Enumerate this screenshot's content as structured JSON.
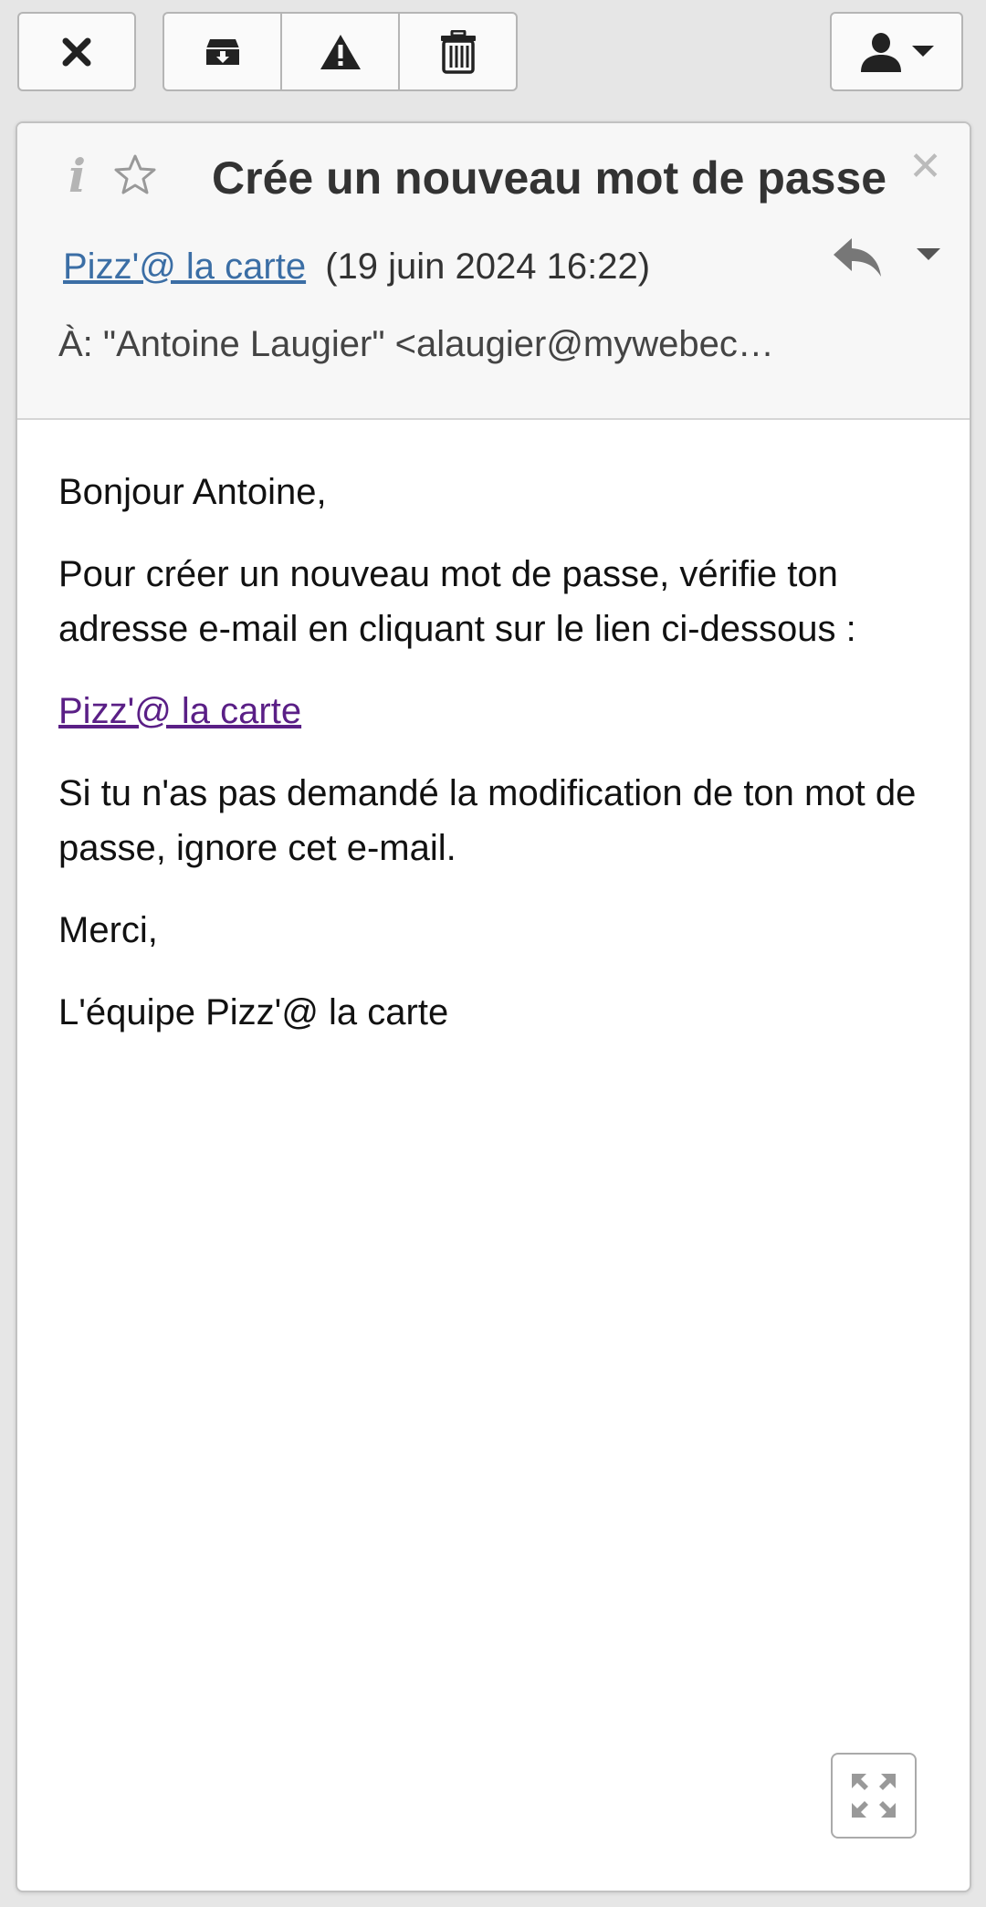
{
  "toolbar": {
    "close": "close-icon",
    "archive": "archive-icon",
    "spam": "warning-icon",
    "delete": "trash-icon",
    "account": "user-icon"
  },
  "message": {
    "subject": "Crée un nouveau mot de passe",
    "sender_name": "Pizz'@ la carte",
    "date": "(19 juin 2024 16:22)",
    "to_line": "À: \"Antoine Laugier\" <alaugier@mywebec…",
    "greeting": "Bonjour Antoine,",
    "paragraph1": "Pour créer un nouveau mot de passe, vérifie ton adresse e-mail en cliquant sur le lien ci-dessous :",
    "link_text": "Pizz'@ la carte",
    "paragraph2": "Si tu n'as pas demandé la modification de ton mot de passe, ignore cet e-mail.",
    "thanks": "Merci,",
    "signature": "L'équipe Pizz'@ la carte"
  },
  "colors": {
    "sender_link": "#3b6ea5",
    "body_link": "#5a1f86",
    "header_bg": "#f7f7f7"
  }
}
